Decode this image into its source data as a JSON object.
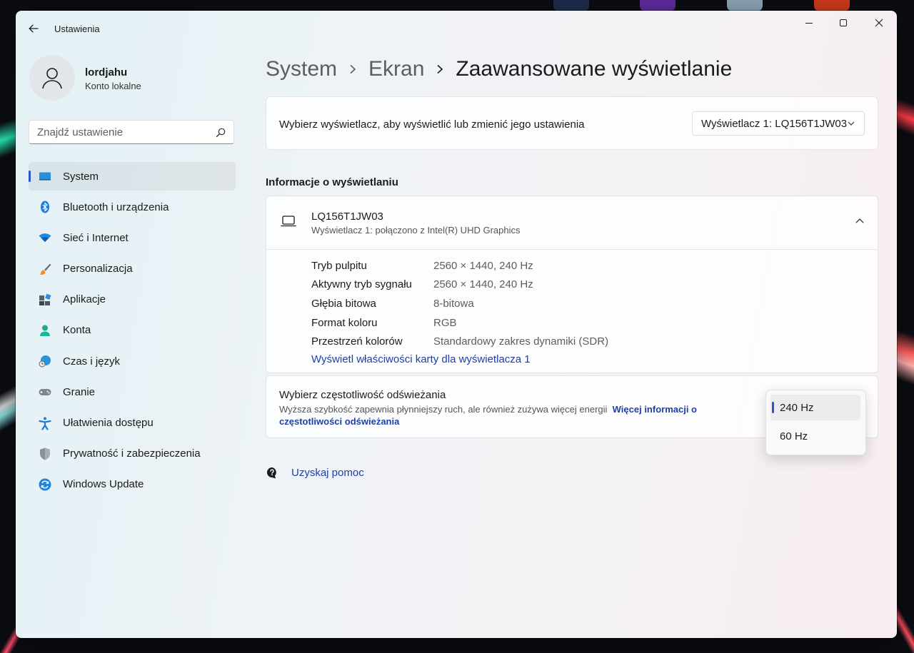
{
  "window": {
    "title": "Ustawienia",
    "controls": {
      "minimize": "minimize-icon",
      "maximize": "maximize-icon",
      "close": "close-icon"
    }
  },
  "profile": {
    "name": "lordjahu",
    "account_type": "Konto lokalne"
  },
  "search": {
    "placeholder": "Znajdź ustawienie"
  },
  "sidebar": {
    "items": [
      {
        "label": "System",
        "icon": "display-icon",
        "active": true
      },
      {
        "label": "Bluetooth i urządzenia",
        "icon": "bluetooth-icon"
      },
      {
        "label": "Sieć i Internet",
        "icon": "wifi-icon"
      },
      {
        "label": "Personalizacja",
        "icon": "brush-icon"
      },
      {
        "label": "Aplikacje",
        "icon": "apps-icon"
      },
      {
        "label": "Konta",
        "icon": "person-icon"
      },
      {
        "label": "Czas i język",
        "icon": "globe-clock-icon"
      },
      {
        "label": "Granie",
        "icon": "gamepad-icon"
      },
      {
        "label": "Ułatwienia dostępu",
        "icon": "accessibility-icon"
      },
      {
        "label": "Prywatność i zabezpieczenia",
        "icon": "shield-icon"
      },
      {
        "label": "Windows Update",
        "icon": "update-icon"
      }
    ]
  },
  "breadcrumb": {
    "level1": "System",
    "level2": "Ekran",
    "current": "Zaawansowane wyświetlanie"
  },
  "display_select": {
    "label": "Wybierz wyświetlacz, aby wyświetlić lub zmienić jego ustawienia",
    "value": "Wyświetlacz 1: LQ156T1JW03"
  },
  "display_info": {
    "section_title": "Informacje o wyświetlaniu",
    "name": "LQ156T1JW03",
    "description": "Wyświetlacz 1: połączono z Intel(R) UHD Graphics",
    "rows": [
      {
        "key": "Tryb pulpitu",
        "value": "2560 × 1440, 240 Hz"
      },
      {
        "key": "Aktywny tryb sygnału",
        "value": "2560 × 1440, 240 Hz"
      },
      {
        "key": "Głębia bitowa",
        "value": "8-bitowa"
      },
      {
        "key": "Format koloru",
        "value": "RGB"
      },
      {
        "key": "Przestrzeń kolorów",
        "value": "Standardowy zakres dynamiki (SDR)"
      }
    ],
    "adapter_link": "Wyświetl właściwości karty dla wyświetlacza 1"
  },
  "refresh_rate": {
    "title": "Wybierz częstotliwość odświeżania",
    "description": "Wyższa szybkość zapewnia płynniejszy ruch, ale również zużywa więcej energii",
    "more_info_link": "Więcej informacji o częstotliwości odświeżania",
    "options": [
      "240 Hz",
      "60 Hz"
    ],
    "selected": "240 Hz"
  },
  "help": {
    "label": "Uzyskaj pomoc"
  },
  "colors": {
    "accent": "#2a55c7",
    "link": "#1f3fa8"
  }
}
